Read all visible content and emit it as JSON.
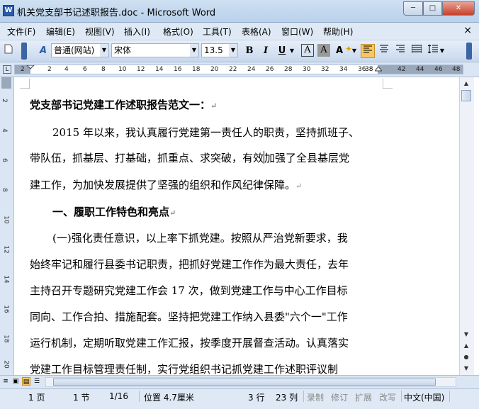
{
  "window": {
    "title": "机关党支部书记述职报告.doc - Microsoft Word",
    "app_icon": "W",
    "min_icon": "minimize-icon",
    "max_icon": "maximize-icon",
    "close_icon": "close-icon"
  },
  "menu": {
    "items": [
      "文件(F)",
      "编辑(E)",
      "视图(V)",
      "插入(I)",
      "格式(O)",
      "工具(T)",
      "表格(A)",
      "窗口(W)",
      "帮助(H)"
    ],
    "close_glyph": "×"
  },
  "toolbar": {
    "style_value": "普通(网站)",
    "font_value": "宋体",
    "size_value": "13.5",
    "bold": "B",
    "italic": "I",
    "underline": "U",
    "font_color": "A",
    "char_shading": "A",
    "highlight": "A"
  },
  "ruler": {
    "numbers": [
      "2",
      "2",
      "4",
      "6",
      "8",
      "10",
      "12",
      "14",
      "16",
      "18",
      "20",
      "22",
      "24",
      "26",
      "28",
      "30",
      "32",
      "34",
      "36",
      "38",
      "42",
      "44",
      "46",
      "48"
    ]
  },
  "vruler": {
    "numbers": [
      "2",
      "4",
      "6",
      "8",
      "10",
      "12",
      "14",
      "16",
      "18",
      "20"
    ]
  },
  "document": {
    "paragraphs": [
      {
        "text": "党支部书记党建工作述职报告范文一：",
        "mark": "↵",
        "type": "heading"
      },
      {
        "text": "2015 年以来，我认真履行党建第一责任人的职责，坚持抓班子、",
        "mark": "",
        "type": "body"
      },
      {
        "text_before": "带队伍，抓基层、打基础，抓重点、求突破，有效",
        "text_after": "加强了全县基层党",
        "mark": "",
        "type": "body-cursor"
      },
      {
        "text": "建工作，为加快发展提供了坚强的组织和作风纪律保障。",
        "mark": "↵",
        "type": "body"
      },
      {
        "text": "一、履职工作特色和亮点",
        "mark": "↵",
        "type": "heading"
      },
      {
        "text": "(一)强化责任意识，以上率下抓党建。按照从严治党新要求，我",
        "mark": "",
        "type": "body"
      },
      {
        "text": "始终牢记和履行县委书记职责，把抓好党建工作作为最大责任，去年",
        "mark": "",
        "type": "body"
      },
      {
        "text": "主持召开专题研究党建工作会 17 次，做到党建工作与中心工作目标",
        "mark": "",
        "type": "body"
      },
      {
        "text": "同向、工作合拍、措施配套。坚持把党建工作纳入县委\"六个一\"工作",
        "mark": "",
        "type": "body"
      },
      {
        "text": "运行机制，定期听取党建工作汇报，按季度开展督查活动。认真落实",
        "mark": "",
        "type": "body"
      },
      {
        "text": "党建工作目标管理责任制，实行党组织书记抓党建工作述职评议制",
        "mark": "",
        "type": "body"
      }
    ]
  },
  "statusbar": {
    "page": "1 页",
    "section": "1 节",
    "page_of": "1/16",
    "position": "位置 4.7厘米",
    "line": "3 行",
    "column": "23 列",
    "rec": "录制",
    "trk": "修订",
    "ext": "扩展",
    "ovr": "改写",
    "language": "中文(中国)"
  }
}
